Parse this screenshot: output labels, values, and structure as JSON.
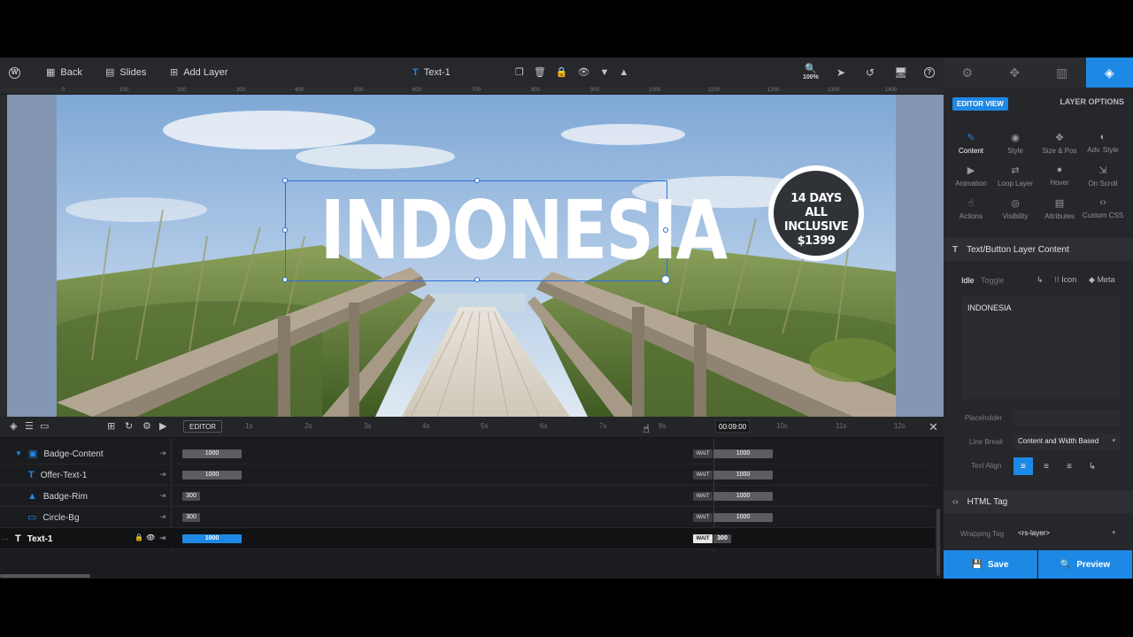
{
  "toolbar": {
    "back_label": "Back",
    "slides_label": "Slides",
    "add_layer_label": "Add Layer",
    "layer_name": "Text-1",
    "zoom": "100%"
  },
  "ruler": [
    "0",
    "100",
    "200",
    "300",
    "400",
    "500",
    "600",
    "700",
    "800",
    "900",
    "1000",
    "1100",
    "1200",
    "1300",
    "1400"
  ],
  "canvas": {
    "title": "INDONESIA",
    "badge_line1": "14 DAYS",
    "badge_line2": "ALL INCLUSIVE",
    "badge_line3": "$1399"
  },
  "timeline": {
    "editor_label": "EDITOR",
    "time": "00:09:00",
    "ticks": [
      "1s",
      "2s",
      "3s",
      "4s",
      "5s",
      "6s",
      "7s",
      "8s",
      "10s",
      "11s",
      "12s"
    ],
    "rows": [
      {
        "name": "Badge-Content",
        "in": "1000",
        "wait": "WAIT",
        "out": "1000"
      },
      {
        "name": "Offer-Text-1",
        "in": "1000",
        "wait": "WAIT",
        "out": "1000"
      },
      {
        "name": "Badge-Rim",
        "in": "300",
        "wait": "WAIT",
        "out": "1000"
      },
      {
        "name": "Circle-Bg",
        "in": "300",
        "wait": "WAIT",
        "out": "1000"
      },
      {
        "name": "Text-1",
        "in": "1000",
        "wait": "WAIT",
        "out": "300"
      }
    ]
  },
  "panel": {
    "editor_view": "EDITOR VIEW",
    "layer_options": "LAYER OPTIONS",
    "options": [
      "Content",
      "Style",
      "Size & Pos",
      "Adv. Style",
      "Animation",
      "Loop Layer",
      "Hover",
      "On Scroll",
      "Actions",
      "Visibility",
      "Attributes",
      "Custom CSS"
    ],
    "section_content": "Text/Button Layer Content",
    "tab_idle": "Idle",
    "tab_toggle": "Toggle",
    "icon_label": "Icon",
    "meta_label": "Meta",
    "content_value": "INDONESIA",
    "placeholder_label": "Placeholder",
    "line_break_label": "Line Break",
    "line_break_value": "Content and Width Based",
    "text_align_label": "Text Align",
    "section_html": "HTML Tag",
    "wrapping_label": "Wrapping Tag",
    "wrapping_value": "<rs-layer>",
    "save_label": "Save",
    "preview_label": "Preview"
  }
}
